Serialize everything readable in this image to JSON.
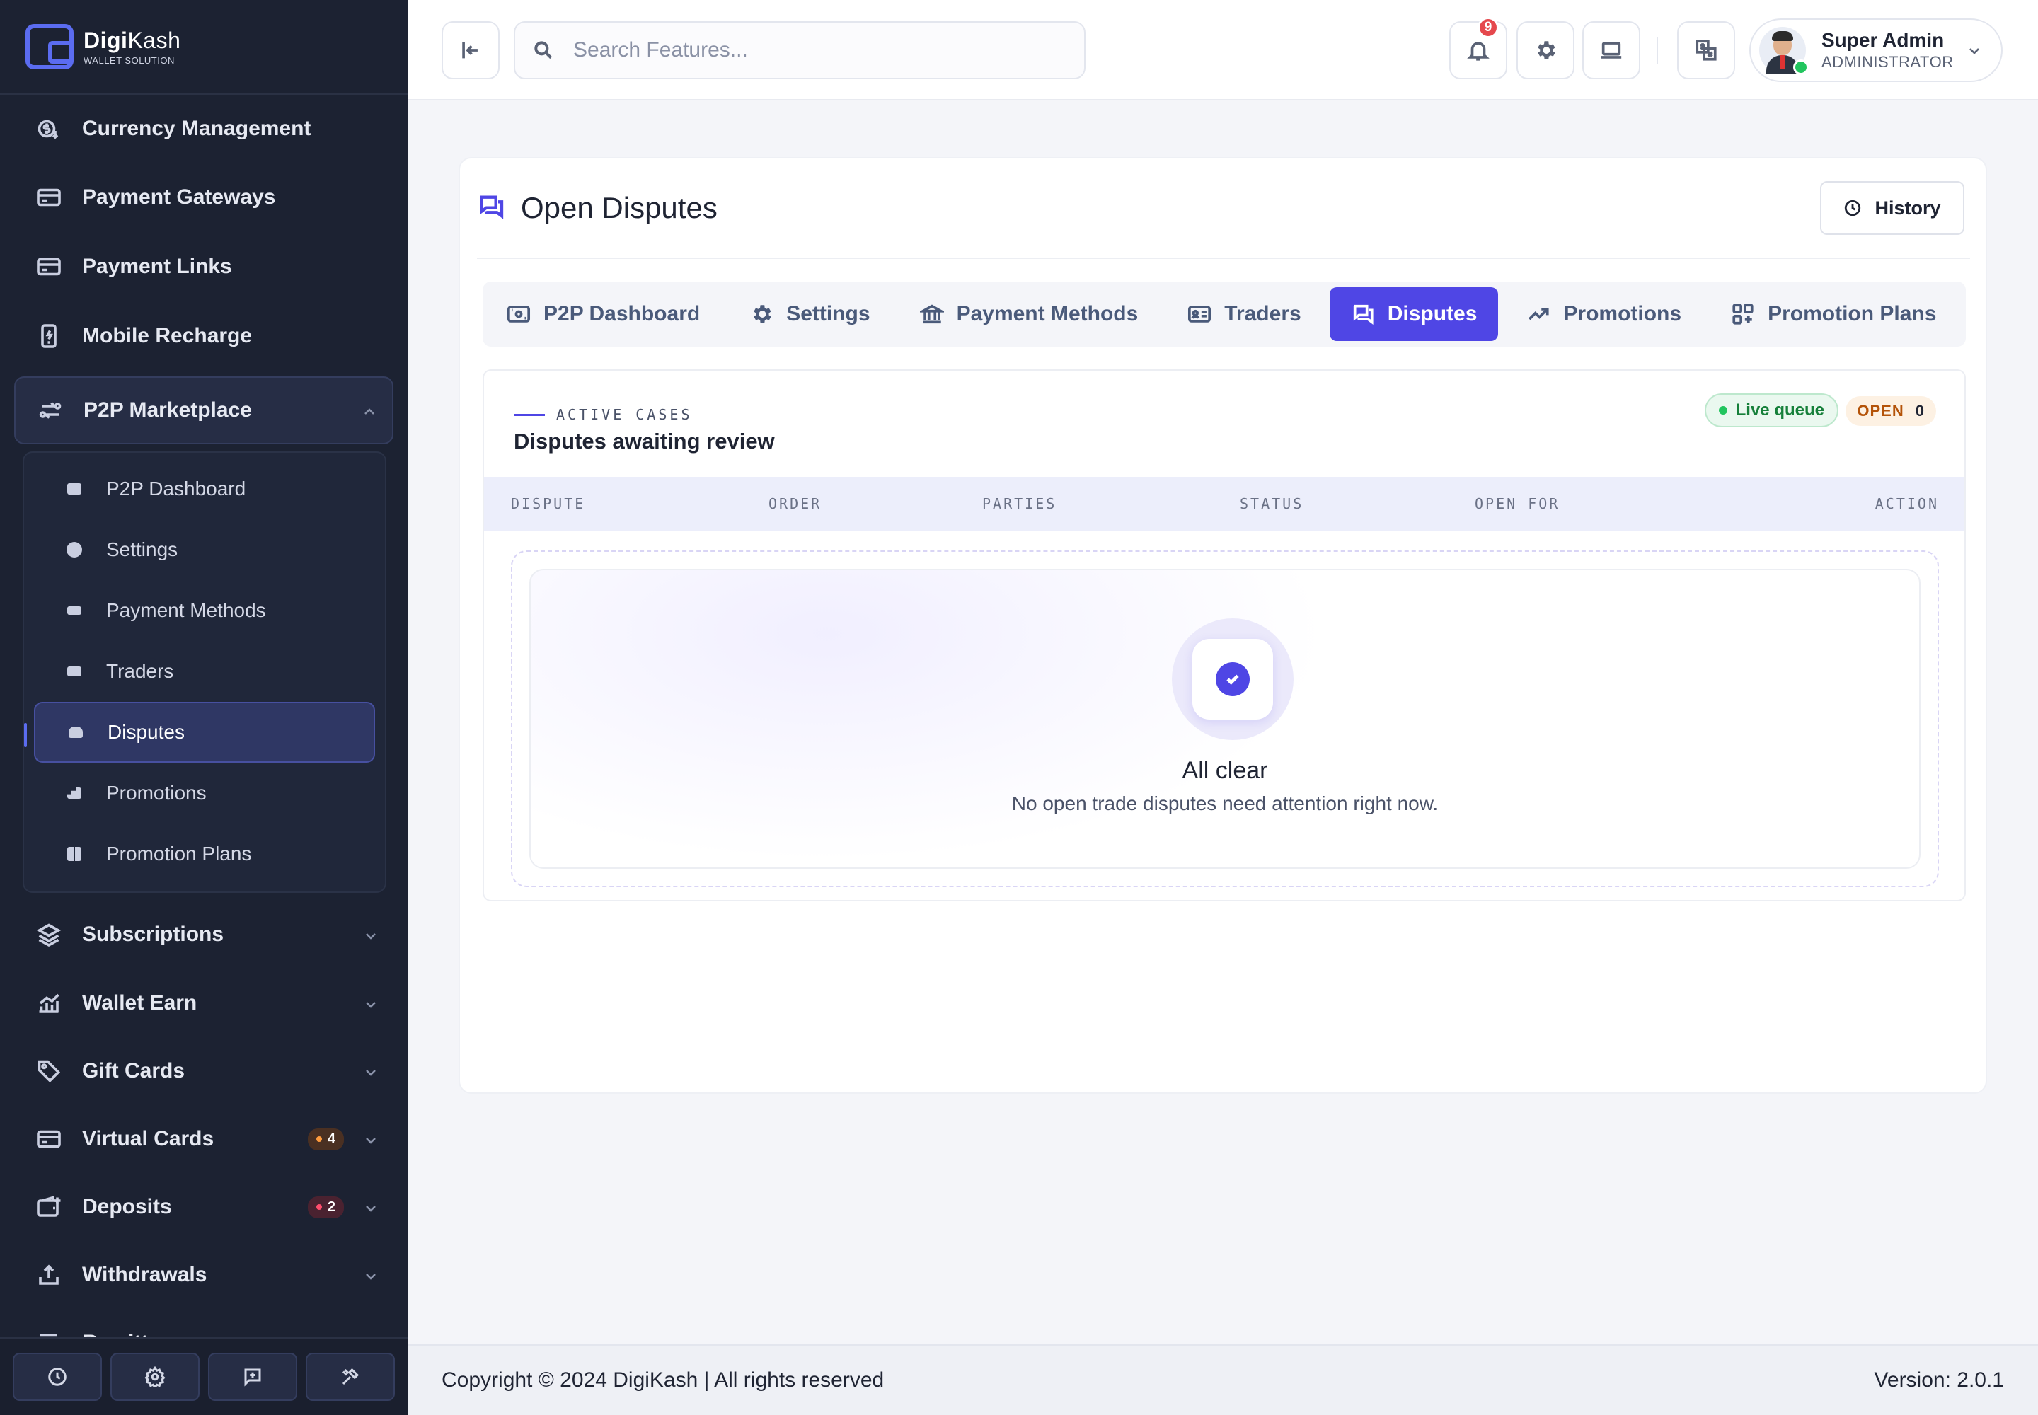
{
  "brand": {
    "name_bold": "Digi",
    "name_light": "Kash",
    "tagline": "WALLET SOLUTION"
  },
  "sidebar": {
    "items_top": [
      {
        "label": "Currency Management",
        "icon": "currency-icon"
      },
      {
        "label": "Payment Gateways",
        "icon": "card-icon"
      },
      {
        "label": "Payment Links",
        "icon": "card-icon"
      },
      {
        "label": "Mobile Recharge",
        "icon": "mobile-icon"
      }
    ],
    "open_group": {
      "label": "P2P Marketplace",
      "icon": "exchange-icon"
    },
    "sub_items": [
      {
        "label": "P2P Dashboard"
      },
      {
        "label": "Settings"
      },
      {
        "label": "Payment Methods"
      },
      {
        "label": "Traders"
      },
      {
        "label": "Disputes",
        "active": true
      },
      {
        "label": "Promotions"
      },
      {
        "label": "Promotion Plans"
      }
    ],
    "items_bottom": [
      {
        "label": "Subscriptions",
        "icon": "layers-icon"
      },
      {
        "label": "Wallet Earn",
        "icon": "chart-icon"
      },
      {
        "label": "Gift Cards",
        "icon": "tag-icon"
      },
      {
        "label": "Virtual Cards",
        "icon": "card-icon",
        "badge": "4"
      },
      {
        "label": "Deposits",
        "icon": "wallet-icon",
        "badge": "2"
      },
      {
        "label": "Withdrawals",
        "icon": "upload-icon"
      },
      {
        "label": "Remittance",
        "icon": "remit-icon"
      }
    ]
  },
  "topbar": {
    "search_placeholder": "Search Features...",
    "notification_count": "9",
    "user": {
      "name": "Super Admin",
      "role": "ADMINISTRATOR"
    }
  },
  "page": {
    "title": "Open Disputes",
    "history_label": "History",
    "tabs": [
      {
        "label": "P2P Dashboard",
        "icon": "dashboard-icon"
      },
      {
        "label": "Settings",
        "icon": "gear-icon"
      },
      {
        "label": "Payment Methods",
        "icon": "bank-icon"
      },
      {
        "label": "Traders",
        "icon": "id-card-icon"
      },
      {
        "label": "Disputes",
        "icon": "chat-icon",
        "active": true
      },
      {
        "label": "Promotions",
        "icon": "trend-icon"
      },
      {
        "label": "Promotion Plans",
        "icon": "grid-icon"
      }
    ],
    "panel": {
      "eyebrow": "ACTIVE CASES",
      "title": "Disputes awaiting review",
      "live_label": "Live queue",
      "open_label": "OPEN",
      "open_count": "0",
      "columns": [
        "DISPUTE",
        "ORDER",
        "PARTIES",
        "STATUS",
        "OPEN FOR",
        "ACTION"
      ],
      "empty_title": "All clear",
      "empty_sub": "No open trade disputes need attention right now."
    }
  },
  "footer": {
    "copyright": "Copyright © 2024 DigiKash | All rights reserved",
    "version": "Version: 2.0.1"
  },
  "colors": {
    "accent": "#4f46e5",
    "sidebar_bg": "#1c2232",
    "success": "#22c55e",
    "warning": "#b45309"
  }
}
